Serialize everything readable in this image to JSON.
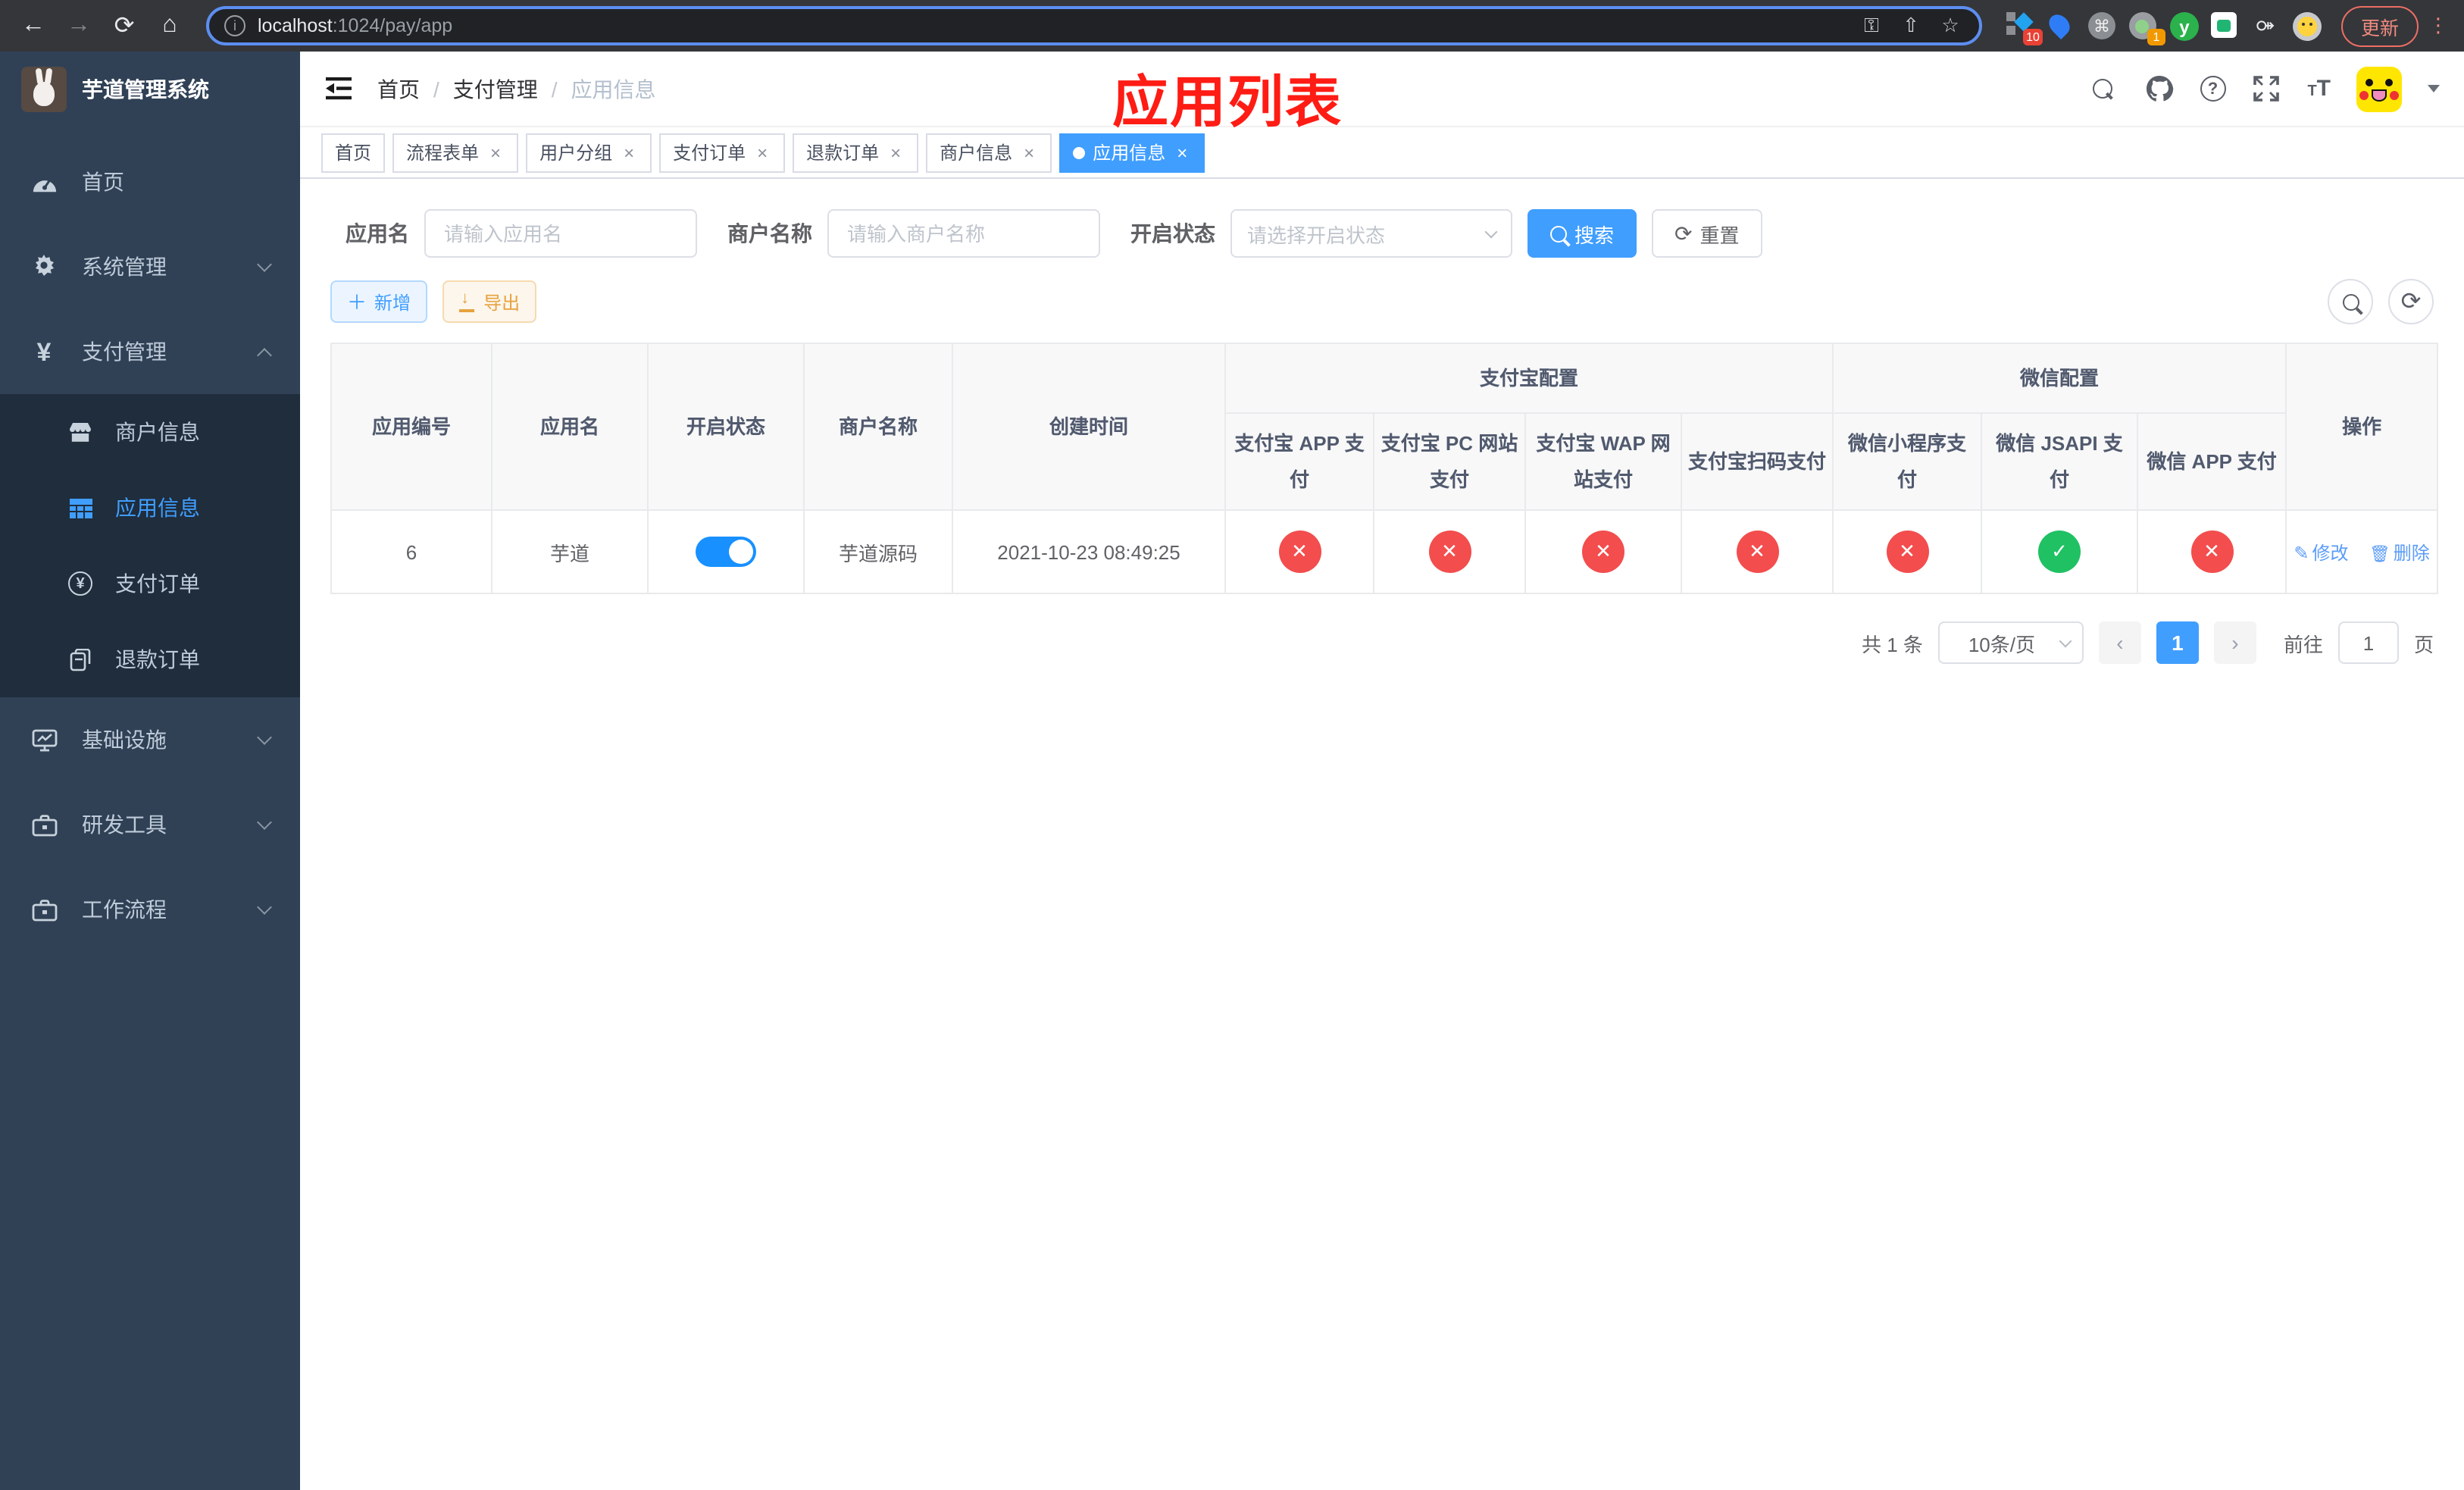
{
  "browser": {
    "url_host": "localhost",
    "url_path": ":1024/pay/app",
    "update_label": "更新",
    "ext_badge_blue": "10",
    "ext_badge_record": "1",
    "ext_y_letter": "y"
  },
  "sidebar": {
    "title": "芋道管理系统",
    "items": [
      {
        "label": "首页"
      },
      {
        "label": "系统管理"
      },
      {
        "label": "支付管理"
      },
      {
        "label": "基础设施"
      },
      {
        "label": "研发工具"
      },
      {
        "label": "工作流程"
      }
    ],
    "sub_items": [
      {
        "label": "商户信息"
      },
      {
        "label": "应用信息"
      },
      {
        "label": "支付订单"
      },
      {
        "label": "退款订单"
      }
    ]
  },
  "header": {
    "breadcrumb": [
      "首页",
      "支付管理",
      "应用信息"
    ],
    "separator": "/",
    "annotation": "应用列表"
  },
  "tabs": [
    {
      "label": "首页",
      "closable": false,
      "active": false
    },
    {
      "label": "流程表单",
      "closable": true,
      "active": false
    },
    {
      "label": "用户分组",
      "closable": true,
      "active": false
    },
    {
      "label": "支付订单",
      "closable": true,
      "active": false
    },
    {
      "label": "退款订单",
      "closable": true,
      "active": false
    },
    {
      "label": "商户信息",
      "closable": true,
      "active": false
    },
    {
      "label": "应用信息",
      "closable": true,
      "active": true
    }
  ],
  "filters": {
    "app_name_label": "应用名",
    "app_name_placeholder": "请输入应用名",
    "merchant_label": "商户名称",
    "merchant_placeholder": "请输入商户名称",
    "status_label": "开启状态",
    "status_placeholder": "请选择开启状态",
    "search_label": "搜索",
    "reset_label": "重置"
  },
  "toolbar": {
    "add_label": "新增",
    "export_label": "导出"
  },
  "table": {
    "col_id": "应用编号",
    "col_name": "应用名",
    "col_status": "开启状态",
    "col_merchant": "商户名称",
    "col_created": "创建时间",
    "group_alipay": "支付宝配置",
    "alipay_cols": [
      "支付宝 APP 支付",
      "支付宝 PC 网站支付",
      "支付宝 WAP 网站支付",
      "支付宝扫码支付"
    ],
    "group_wechat": "微信配置",
    "wechat_cols": [
      "微信小程序支付",
      "微信 JSAPI 支付",
      "微信 APP 支付"
    ],
    "col_ops": "操作",
    "rows": [
      {
        "id": "6",
        "name": "芋道",
        "enabled": true,
        "merchant": "芋道源码",
        "created": "2021-10-23 08:49:25",
        "channels": [
          "no",
          "no",
          "no",
          "no",
          "no",
          "yes",
          "no"
        ],
        "edit_label": "修改",
        "delete_label": "删除"
      }
    ]
  },
  "pagination": {
    "total": "共 1 条",
    "page_size": "10条/页",
    "current_page": "1",
    "goto_label": "前往",
    "goto_value": "1",
    "page_suffix": "页"
  },
  "colors": {
    "accent": "#409eff",
    "success": "#1fc163",
    "danger": "#f34d4d",
    "sidebar_bg": "#304156",
    "submenu_bg": "#1f2d3d",
    "annotation_red": "#fe1c14"
  }
}
